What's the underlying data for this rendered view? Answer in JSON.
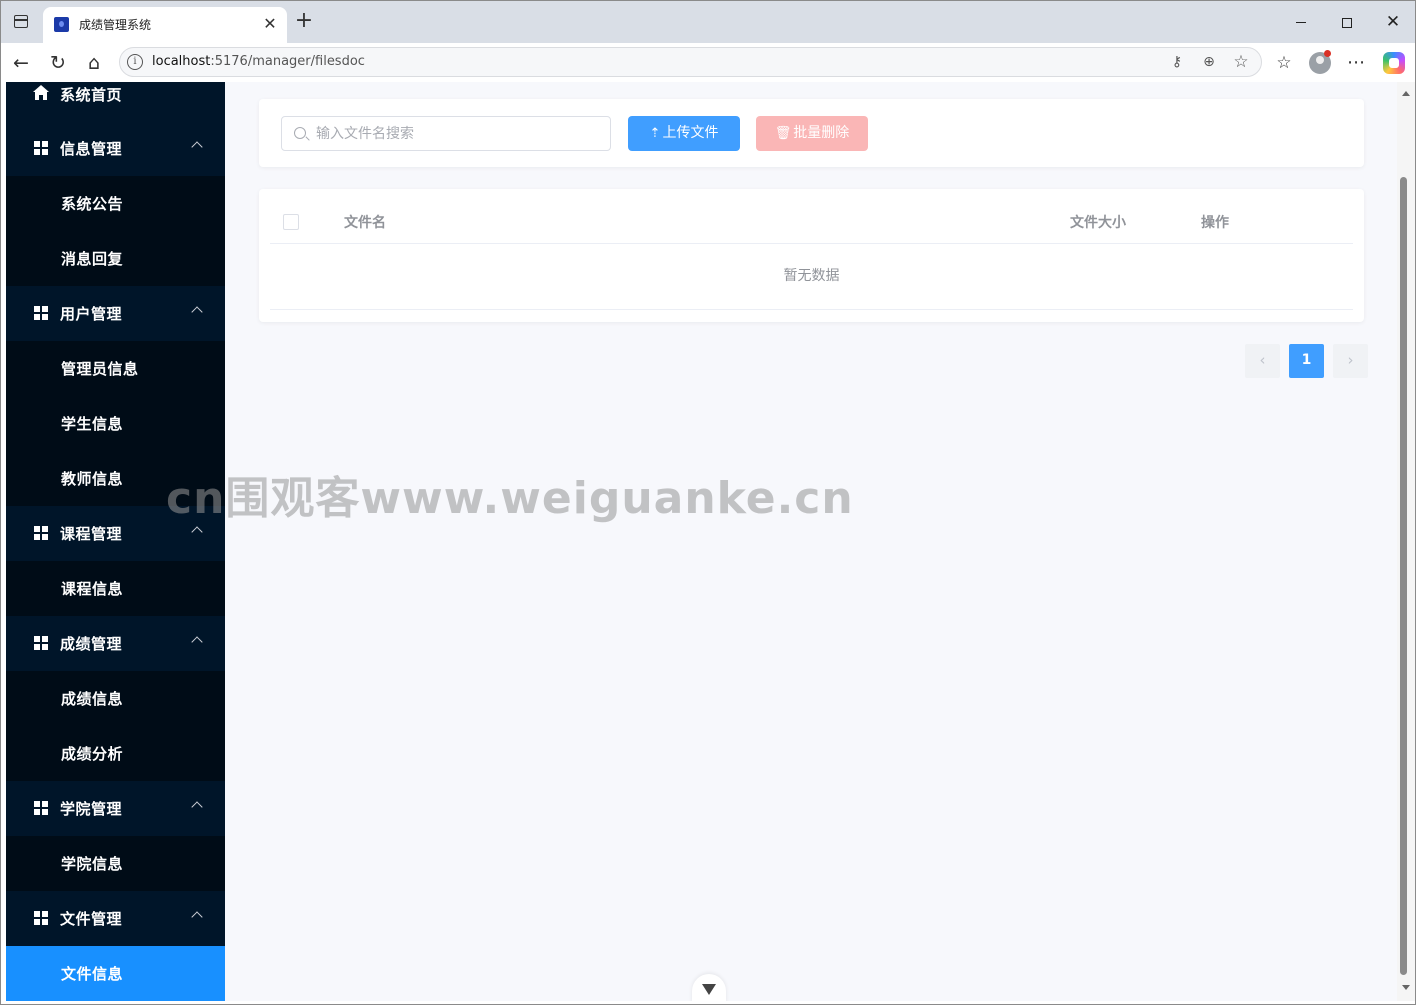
{
  "browser": {
    "tab_title": "成绩管理系统",
    "url_host": "localhost",
    "url_rest": ":5176/manager/filesdoc",
    "icons": [
      "sidebar-toggle-icon",
      "favicon-icon",
      "close-icon",
      "plus-icon",
      "minimize-icon",
      "maximize-icon",
      "back-icon",
      "reload-icon",
      "home-icon",
      "info-icon",
      "key-icon",
      "zoom-icon",
      "star-icon",
      "favorites-icon",
      "profile-icon",
      "more-icon",
      "copilot-icon"
    ]
  },
  "sidebar": {
    "home": "系统首页",
    "groups": [
      {
        "label": "信息管理",
        "items": [
          "系统公告",
          "消息回复"
        ]
      },
      {
        "label": "用户管理",
        "items": [
          "管理员信息",
          "学生信息",
          "教师信息"
        ]
      },
      {
        "label": "课程管理",
        "items": [
          "课程信息"
        ]
      },
      {
        "label": "成绩管理",
        "items": [
          "成绩信息",
          "成绩分析"
        ]
      },
      {
        "label": "学院管理",
        "items": [
          "学院信息"
        ]
      },
      {
        "label": "文件管理",
        "items": [
          "文件信息"
        ]
      }
    ],
    "active_item": "文件信息",
    "colors": {
      "background": "#001529",
      "submenu": "#000c17",
      "active": "#1890ff"
    }
  },
  "toolbar": {
    "search_placeholder": "输入文件名搜索",
    "upload_label": "上传文件",
    "batch_delete_label": "批量删除",
    "colors": {
      "primary": "#409eff",
      "danger_disabled": "#fab6b6"
    }
  },
  "table": {
    "columns": [
      "文件名",
      "文件大小",
      "操作"
    ],
    "rows": [],
    "empty_text": "暂无数据"
  },
  "pagination": {
    "prev": "‹",
    "current_page": "1",
    "next": "›"
  },
  "watermark": "cn围观客www.weiguanke.cn"
}
